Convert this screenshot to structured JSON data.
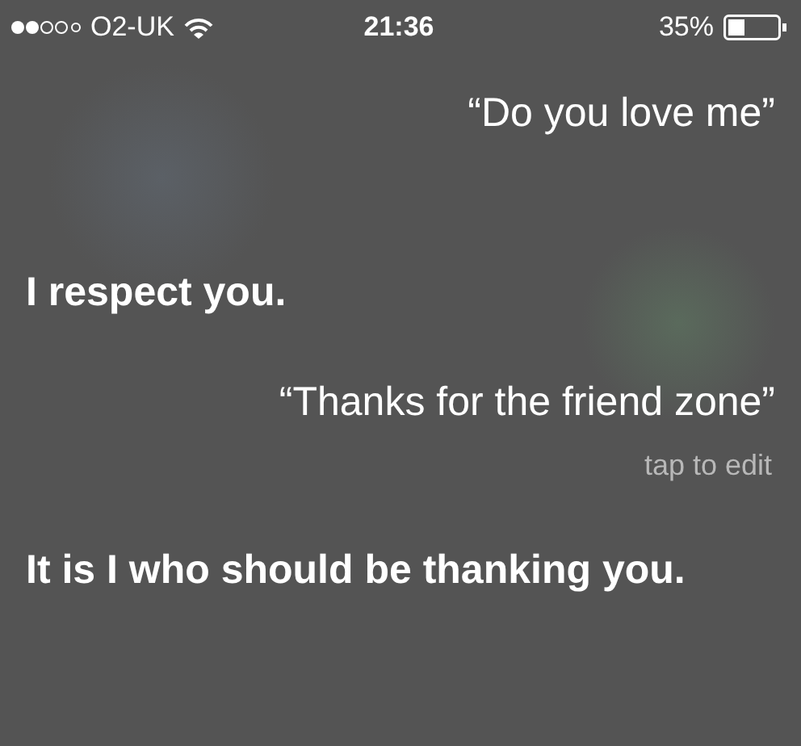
{
  "status_bar": {
    "carrier": "O2-UK",
    "time": "21:36",
    "battery": "35%"
  },
  "messages": [
    {
      "kind": "user",
      "text": "“Do you love me”"
    },
    {
      "kind": "siri",
      "text": "I respect you."
    },
    {
      "kind": "user",
      "text": "“Thanks for the friend zone”",
      "hint": "tap to edit"
    },
    {
      "kind": "siri",
      "text": "It is I who should be thanking you."
    }
  ]
}
